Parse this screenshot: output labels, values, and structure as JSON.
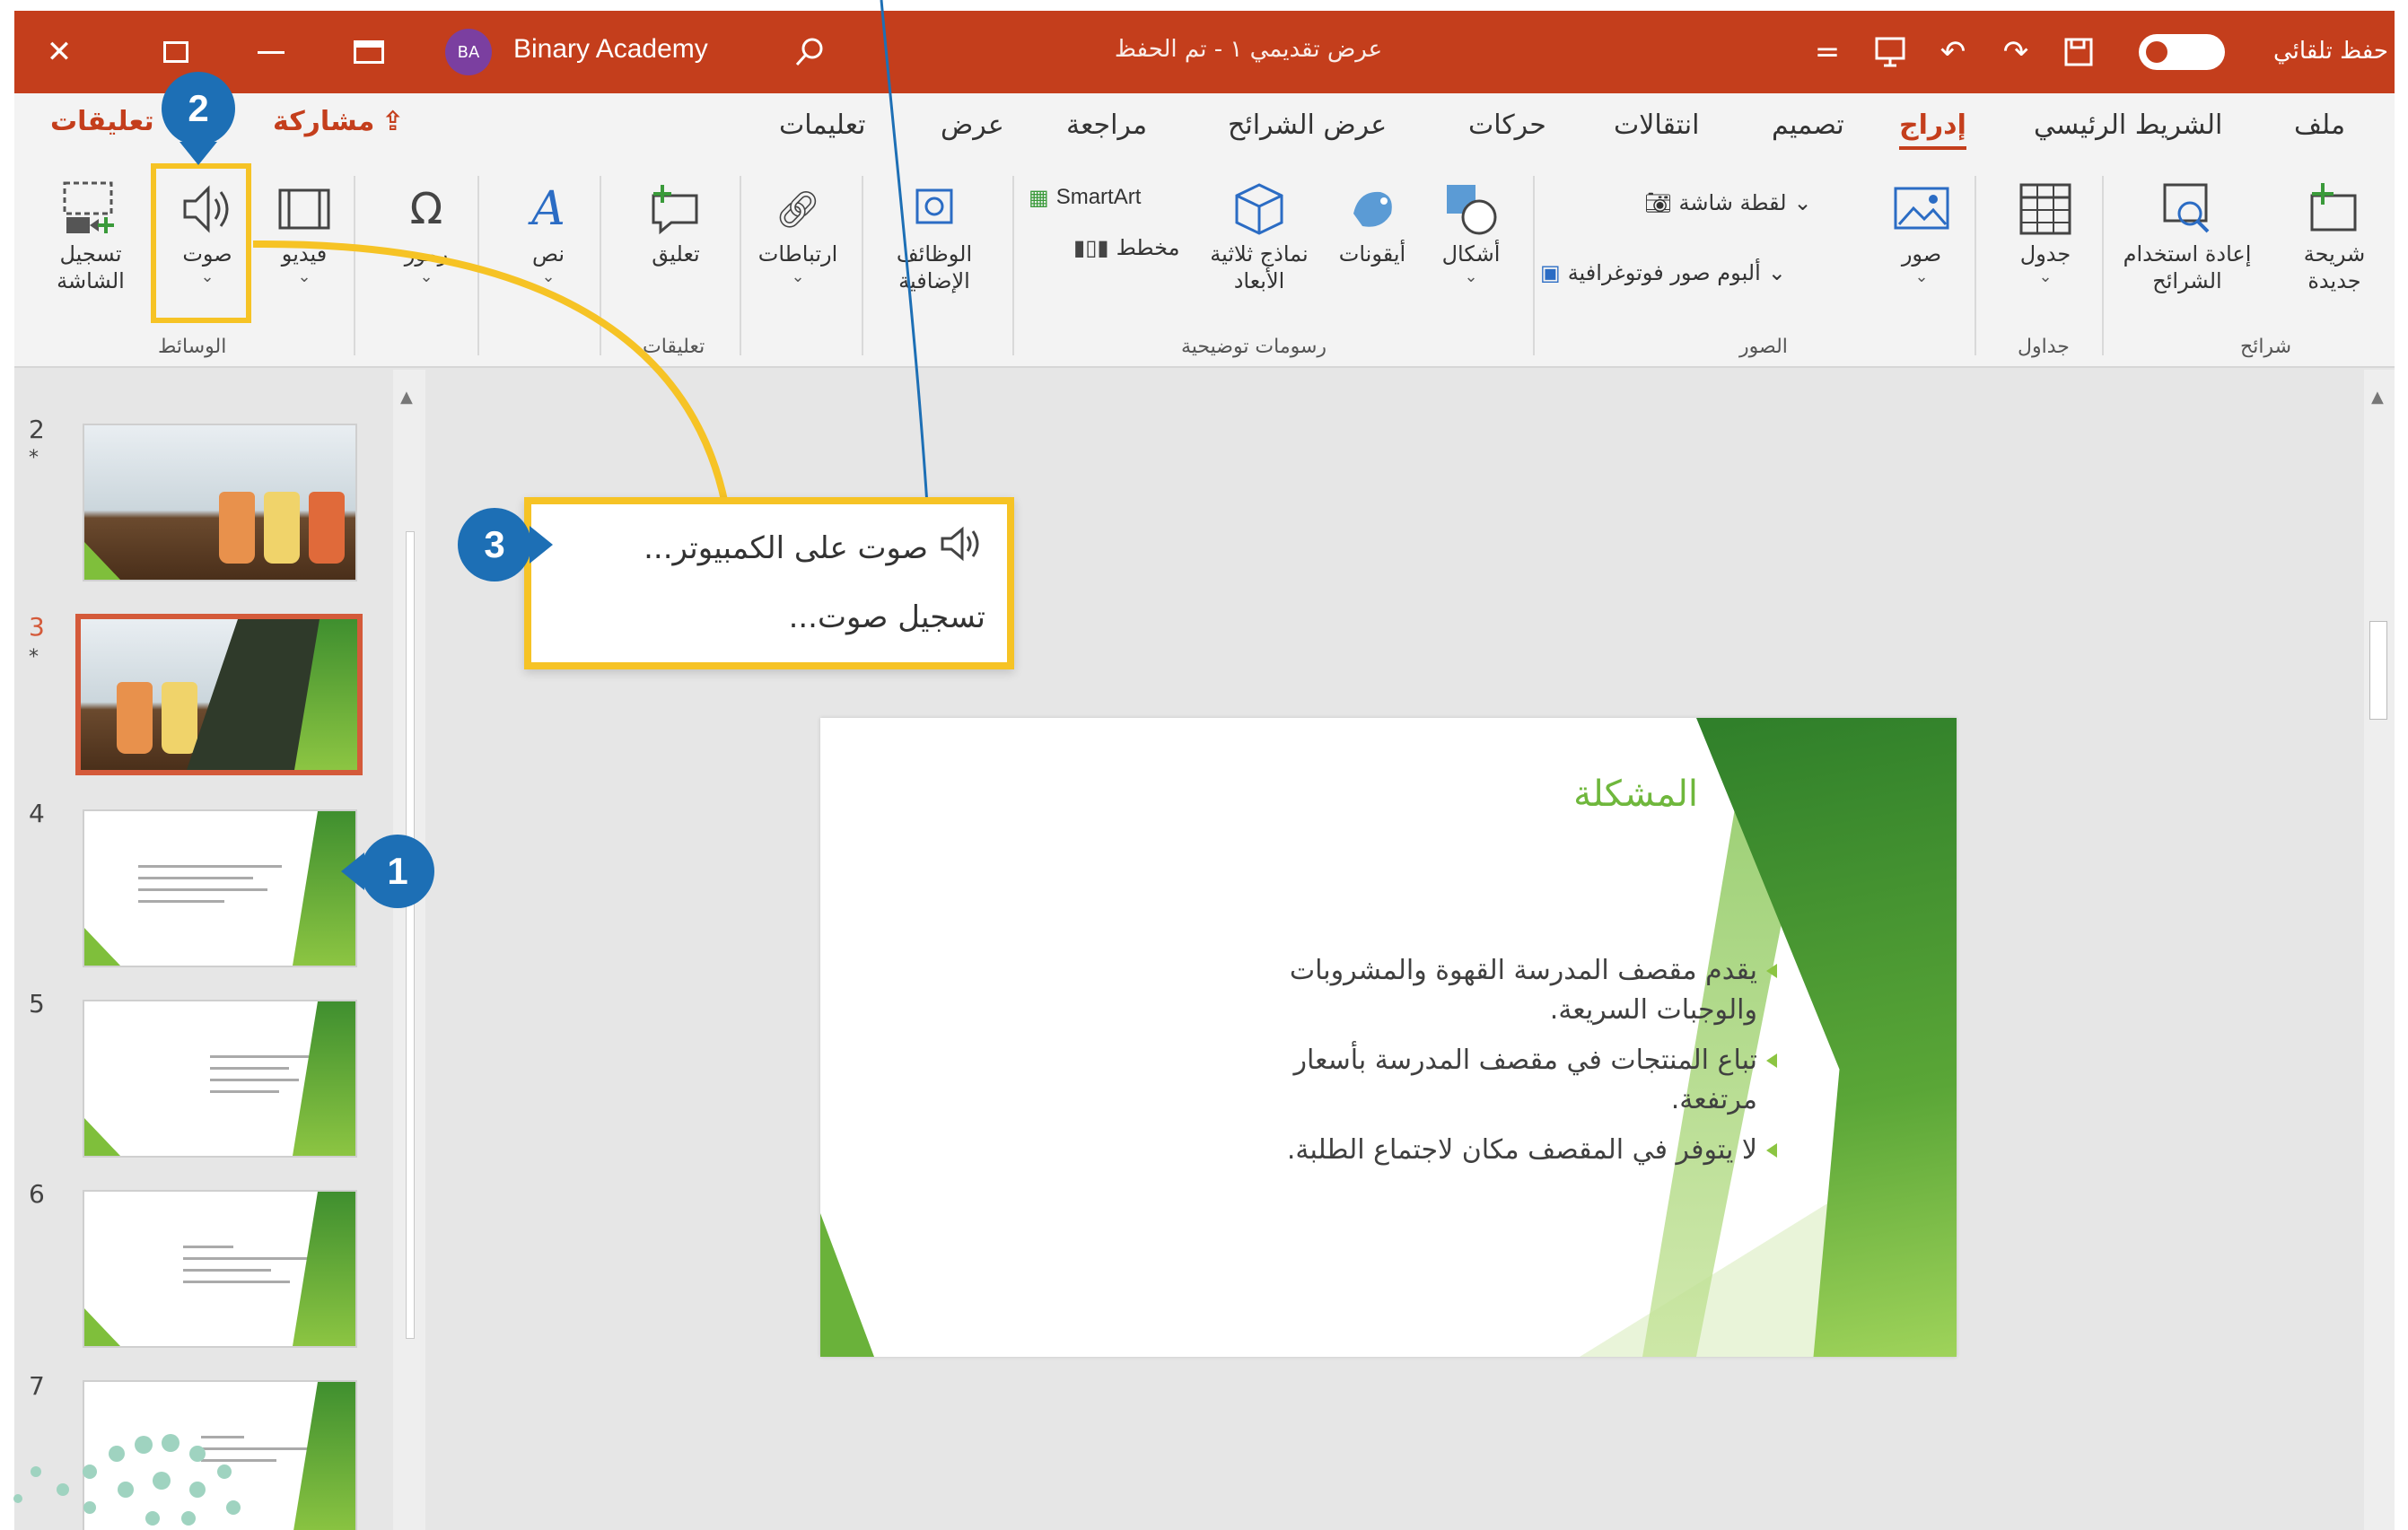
{
  "titlebar": {
    "user_name": "Binary Academy",
    "avatar_initials": "BA",
    "document_title": "عرض تقديمي ١ - تم الحفظ",
    "autosave_label": "حفظ تلقائي",
    "accent_color": "#c43e1c"
  },
  "tabs": {
    "file": "ملف",
    "home": "الشريط الرئيسي",
    "insert": "إدراج",
    "design": "تصميم",
    "transitions": "انتقالات",
    "animations": "حركات",
    "slideshow": "عرض الشرائح",
    "review": "مراجعة",
    "view": "عرض",
    "help": "تعليمات",
    "share": "مشاركة",
    "comments": "تعليقات"
  },
  "ribbon": {
    "slides": {
      "new_slide": "شريحة\nجديدة",
      "reuse_slides": "إعادة استخدام\nالشرائح",
      "group_label": "شرائح"
    },
    "tables": {
      "table": "جدول",
      "group_label": "جداول"
    },
    "images": {
      "pictures": "صور",
      "screenshot": "لقطة شاشة",
      "photo_album": "ألبوم صور فوتوغرافية",
      "group_label": "الصور"
    },
    "illustrations": {
      "shapes": "أشكال",
      "icons": "أيقونات",
      "models_3d": "نماذج ثلاثية\nالأبعاد",
      "smartart": "SmartArt",
      "chart": "مخطط",
      "group_label": "رسومات توضيحية"
    },
    "addins": {
      "addins": "الوظائف\nالإضافية"
    },
    "links": {
      "links": "ارتباطات"
    },
    "comments": {
      "comment": "تعليق",
      "group_label": "تعليقات"
    },
    "text": {
      "text": "نص"
    },
    "symbols": {
      "symbols": "رموز"
    },
    "media": {
      "video": "فيديو",
      "audio": "صوت",
      "screen_recording": "تسجيل\nالشاشة",
      "group_label": "الوسائط"
    }
  },
  "audio_menu": {
    "audio_on_pc": "صوت على الكمبيوتر...",
    "record_audio": "تسجيل صوت..."
  },
  "thumbnails": [
    {
      "number": "2",
      "star": "*"
    },
    {
      "number": "3",
      "star": "*"
    },
    {
      "number": "4"
    },
    {
      "number": "5"
    },
    {
      "number": "6"
    },
    {
      "number": "7"
    }
  ],
  "slide": {
    "title": "المشكلة",
    "bullets": [
      "يقدم مقصف المدرسة القهوة والمشروبات والوجبات السريعة.",
      "تباع المنتجات في مقصف المدرسة بأسعار مرتفعة.",
      "لا يتوفر في المقصف مكان لاجتماع الطلبة."
    ]
  },
  "callouts": {
    "one": "1",
    "two": "2",
    "three": "3",
    "color": "#1d6fb5",
    "highlight_color": "#f6c325"
  }
}
